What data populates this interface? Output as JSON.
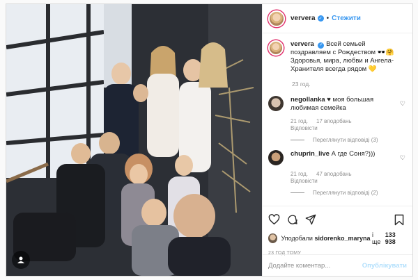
{
  "header": {
    "username": "ververa",
    "follow_label": "Стежити",
    "dot": "•"
  },
  "caption": {
    "username": "ververa",
    "text": "Всей семьей поздравляем с Рождеством 🕶️🤗 Здоровья, мира, любви и Ангела-Хранителя всегда рядом 💛",
    "time": "23 год."
  },
  "comments": [
    {
      "username": "negollanka",
      "text": "♥ моя большая любимая семейка",
      "time": "21 год.",
      "likes": "17 вподобань",
      "reply_label": "Відповісти",
      "replies_label": "Переглянути відповіді (3)"
    },
    {
      "username": "chuprin_live",
      "text": "А где Соня?)))",
      "time": "21 год.",
      "likes": "47 вподобань",
      "reply_label": "Відповісти",
      "replies_label": "Переглянути відповіді (2)"
    }
  ],
  "likes": {
    "prefix": "Уподобали",
    "user": "sidorenko_maryna",
    "middle": "і ще",
    "count": "133 938"
  },
  "ago": "23 год тому",
  "comment_input": {
    "placeholder": "Додайте коментар...",
    "post_label": "Опублікувати"
  },
  "icons": [
    "heart-icon",
    "comment-icon",
    "share-icon",
    "bookmark-icon",
    "verified-icon",
    "person-icon"
  ],
  "colors": {
    "accent": "#3897f0",
    "muted": "#8e8e8e",
    "post_disabled": "#b2dffc"
  }
}
